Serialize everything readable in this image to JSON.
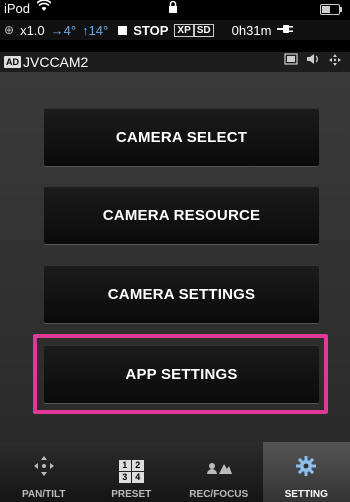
{
  "status_bar": {
    "carrier": "iPod",
    "wifi_icon": "wifi-icon",
    "lock_icon": "lock-icon",
    "battery_icon": "battery-icon"
  },
  "info_row": {
    "zoom": "x1.0",
    "pan_value": "→4°",
    "tilt_value": "↑14°",
    "rec_status": "STOP",
    "format1": "XP",
    "format2": "SD",
    "remaining": "0h31m"
  },
  "camera_row": {
    "badge": "AD",
    "name": "JVCCAM2"
  },
  "menu": {
    "buttons": [
      {
        "label": "CAMERA SELECT"
      },
      {
        "label": "CAMERA RESOURCE"
      },
      {
        "label": "CAMERA SETTINGS"
      },
      {
        "label": "APP SETTINGS"
      }
    ],
    "highlight_color": "#e0399a"
  },
  "tabs": [
    {
      "label": "PAN/TILT",
      "icon": "pan-tilt-icon"
    },
    {
      "label": "PRESET",
      "icon": "preset-grid-icon",
      "grid": [
        "1",
        "2",
        "3",
        "4"
      ]
    },
    {
      "label": "REC/FOCUS",
      "icon": "rec-focus-icon"
    },
    {
      "label": "SETTING",
      "icon": "gear-icon",
      "active": true
    }
  ]
}
